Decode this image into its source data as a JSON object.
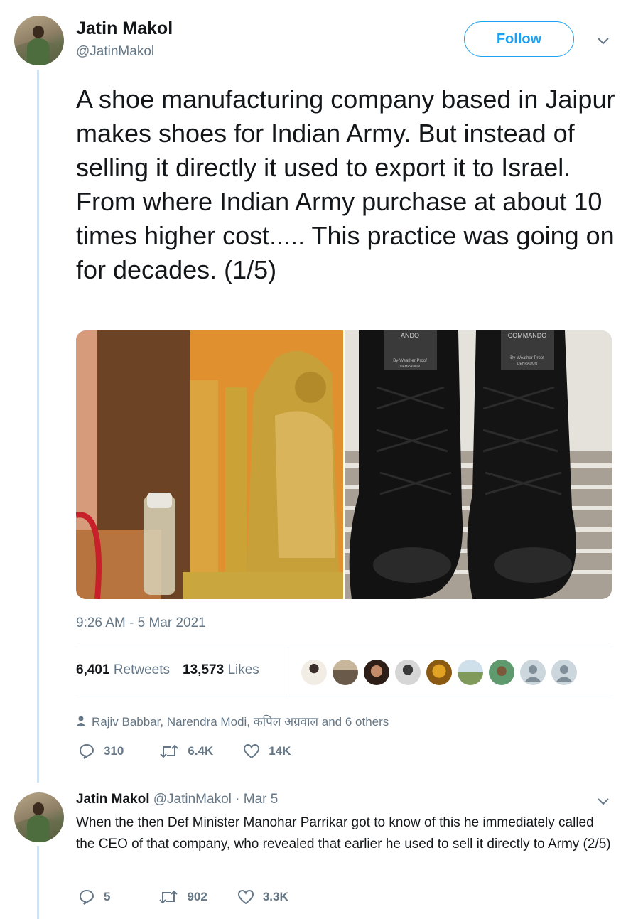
{
  "tweet": {
    "author_name": "Jatin Makol",
    "author_handle": "@JatinMakol",
    "follow_label": "Follow",
    "text": "A shoe manufacturing company based in Jaipur makes shoes for Indian Army. But instead of selling it directly it used to export it to Israel. From where Indian Army purchase at about 10 times higher cost..... This practice was going on for decades. (1/5)",
    "timestamp": "9:26 AM - 5 Mar 2021",
    "retweets_count": "6,401",
    "retweets_label": "Retweets",
    "likes_count": "13,573",
    "likes_label": "Likes",
    "liked_by": "Rajiv Babbar, Narendra Modi, कपिल अग्रवाल and 6 others",
    "actions": {
      "replies": "310",
      "retweets": "6.4K",
      "likes": "14K"
    },
    "boot_tongue_left": "ANDO",
    "boot_tongue_right": "COMMANDO",
    "boot_tongue_sub": "By-Weather Proof",
    "boot_tongue_city": "DEHRADUN"
  },
  "reply": {
    "author_name": "Jatin Makol",
    "author_handle": "@JatinMakol",
    "date": "· Mar 5",
    "text": "When the then Def Minister Manohar Parrikar got to know of this he immediately called the CEO of that company, who revealed that earlier he used to sell it directly to Army (2/5)",
    "actions": {
      "replies": "5",
      "retweets": "902",
      "likes": "3.3K"
    }
  },
  "colors": {
    "accent": "#1da1f2",
    "muted": "#657786",
    "thread_line": "#cfe3f5"
  }
}
